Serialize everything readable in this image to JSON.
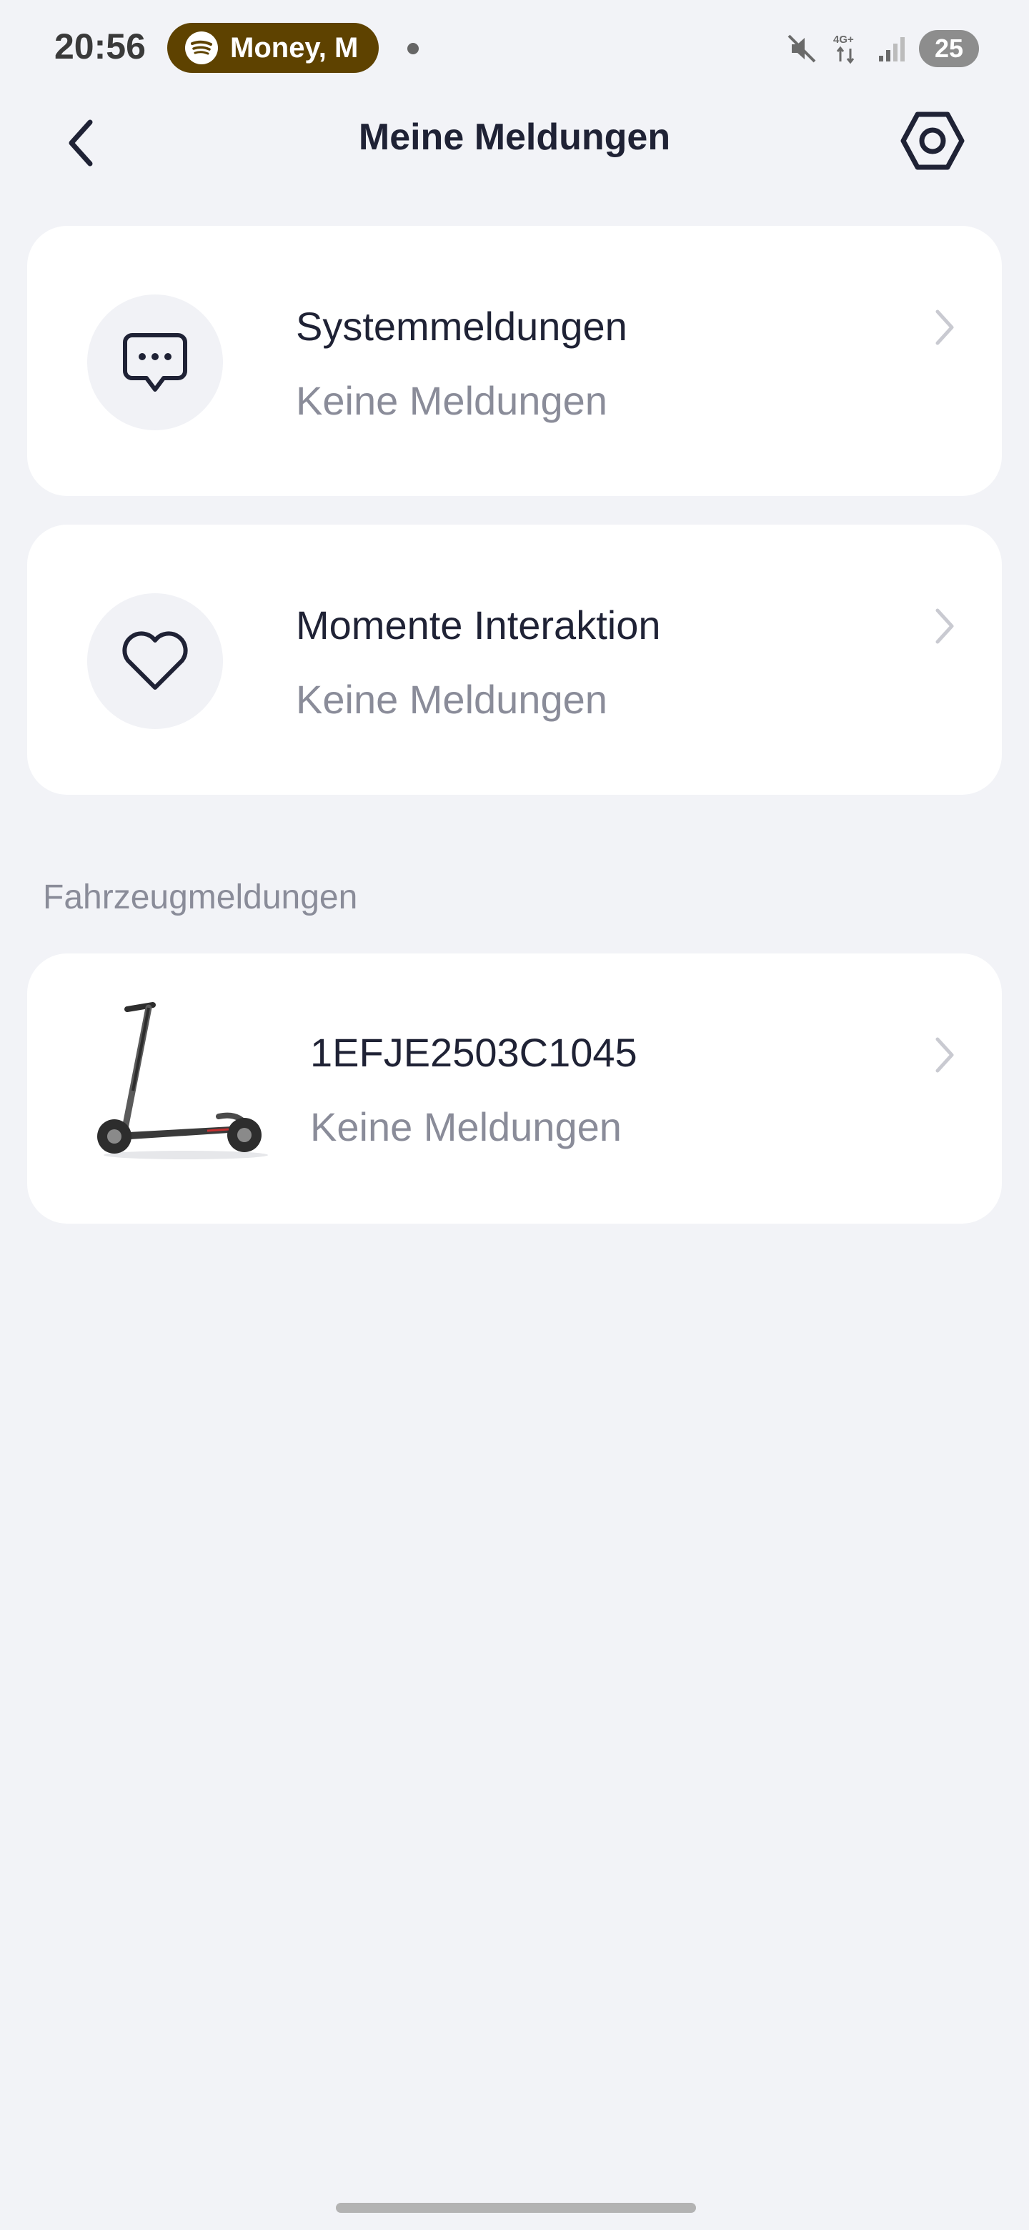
{
  "status_bar": {
    "time": "20:56",
    "media_text": "Money, M",
    "network": "4G+",
    "battery": "25"
  },
  "header": {
    "title": "Meine Meldungen"
  },
  "cards": [
    {
      "title": "Systemmeldungen",
      "subtitle": "Keine Meldungen",
      "icon": "chat-bubble-icon"
    },
    {
      "title": "Momente Interaktion",
      "subtitle": "Keine Meldungen",
      "icon": "heart-icon"
    }
  ],
  "section": {
    "label": "Fahrzeugmeldungen"
  },
  "vehicle": {
    "serial": "1EFJE2503C1045",
    "subtitle": "Keine Meldungen",
    "image": "scooter-image"
  },
  "colors": {
    "background": "#f2f3f7",
    "card": "#ffffff",
    "text_primary": "#1f2235",
    "text_secondary": "#8a8c99",
    "media_pill": "#5e4200"
  }
}
